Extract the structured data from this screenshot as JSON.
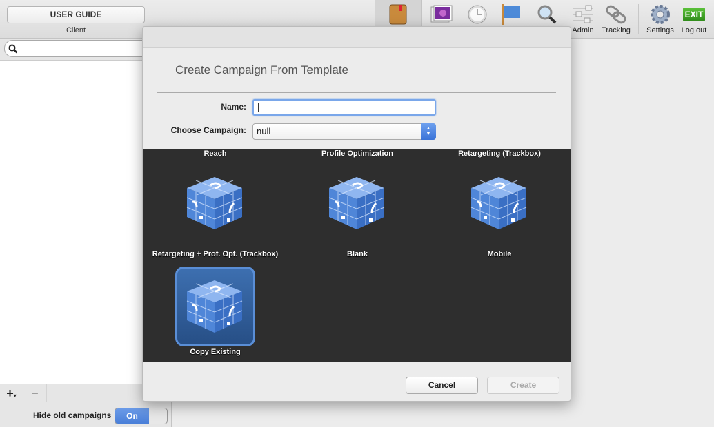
{
  "toolbar": {
    "user_guide": "USER GUIDE",
    "client_label": "Client",
    "items": [
      {
        "icon": "book-icon",
        "label": ""
      },
      {
        "icon": "photo-icon",
        "label": ""
      },
      {
        "icon": "clock-icon",
        "label": ""
      },
      {
        "icon": "flag-icon",
        "label": ""
      },
      {
        "icon": "magnifier-icon",
        "label": ""
      },
      {
        "icon": "sliders-icon",
        "label": "Admin"
      },
      {
        "icon": "chain-link-icon",
        "label": "Tracking"
      },
      {
        "icon": "gear-icon",
        "label": "Settings"
      },
      {
        "icon": "exit-icon",
        "label": "Log out",
        "badge": "EXIT"
      }
    ]
  },
  "sidebar": {
    "search_placeholder": "",
    "add": "+",
    "add_caret": "▾",
    "remove": "−",
    "hide_old_label": "Hide old campaigns",
    "toggle": "On"
  },
  "modal": {
    "title": "Create Campaign From Template",
    "name_label": "Name:",
    "name_value": "",
    "choose_label": "Choose Campaign:",
    "choose_value": "null",
    "templates": [
      {
        "label": "Reach"
      },
      {
        "label": "Profile Optimization"
      },
      {
        "label": "Retargeting (Trackbox)"
      },
      {
        "label": "Retargeting + Prof. Opt. (Trackbox)"
      },
      {
        "label": "Blank"
      },
      {
        "label": "Mobile"
      },
      {
        "label": "Copy Existing",
        "selected": true
      }
    ],
    "cancel": "Cancel",
    "create": "Create"
  },
  "colors": {
    "accent": "#4a7fd8",
    "grid_bg": "#2e2e2e",
    "cube": "#4f86d8"
  }
}
